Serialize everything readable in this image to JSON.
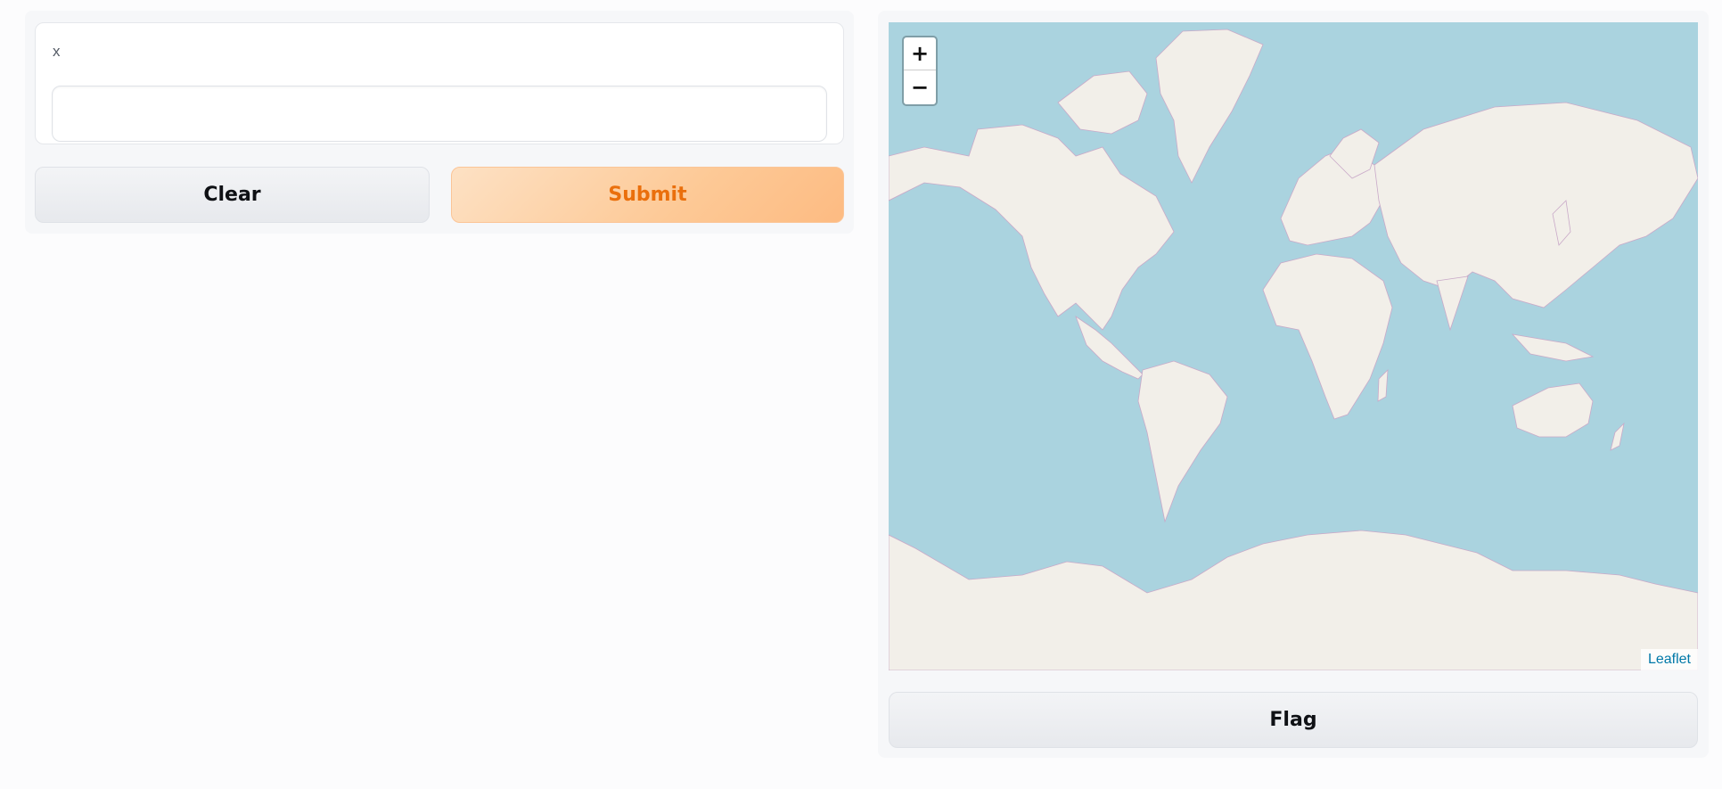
{
  "form": {
    "input_label": "x",
    "input_value": "",
    "input_placeholder": "",
    "clear_label": "Clear",
    "submit_label": "Submit"
  },
  "map": {
    "zoom_in_label": "+",
    "zoom_out_label": "−",
    "attribution": "Leaflet"
  },
  "flag_label": "Flag",
  "colors": {
    "water": "#aad3df",
    "land": "#f2efe9",
    "border": "#c9a9c8",
    "accent": "#ea6f0c",
    "attribution_link": "#0078a8"
  }
}
